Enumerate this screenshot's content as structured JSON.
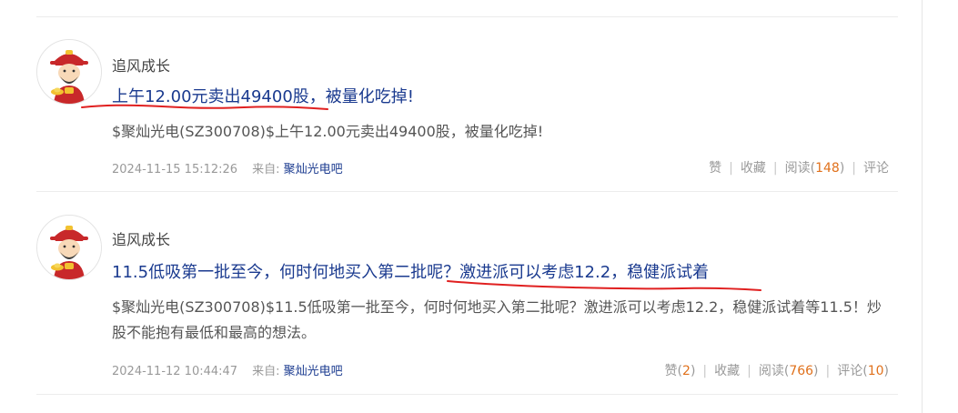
{
  "posts": [
    {
      "author": "追风成长",
      "title": "上午12.00元卖出49400股，被量化吃掉!",
      "body": "$聚灿光电(SZ300708)$上午12.00元卖出49400股，被量化吃掉!",
      "timestamp": "2024-11-15 15:12:26",
      "from_label": "来自:",
      "forum": "聚灿光电吧",
      "actions": {
        "like": "赞",
        "like_count": "",
        "collect": "收藏",
        "read": "阅读",
        "read_count": "148",
        "comment": "评论",
        "comment_count": ""
      }
    },
    {
      "author": "追风成长",
      "title": "11.5低吸第一批至今，何时何地买入第二批呢？激进派可以考虑12.2，稳健派试着",
      "body": "$聚灿光电(SZ300708)$11.5低吸第一批至今，何时何地买入第二批呢？激进派可以考虑12.2，稳健派试着等11.5！炒股不能抱有最低和最高的想法。",
      "timestamp": "2024-11-12 10:44:47",
      "from_label": "来自:",
      "forum": "聚灿光电吧",
      "actions": {
        "like": "赞",
        "like_count": "2",
        "collect": "收藏",
        "read": "阅读",
        "read_count": "766",
        "comment": "评论",
        "comment_count": "10"
      }
    }
  ],
  "icons": {
    "avatar": "caishen-avatar-icon"
  },
  "colors": {
    "title": "#1a3a8f",
    "count": "#e0711c",
    "annotation": "#e02020"
  }
}
